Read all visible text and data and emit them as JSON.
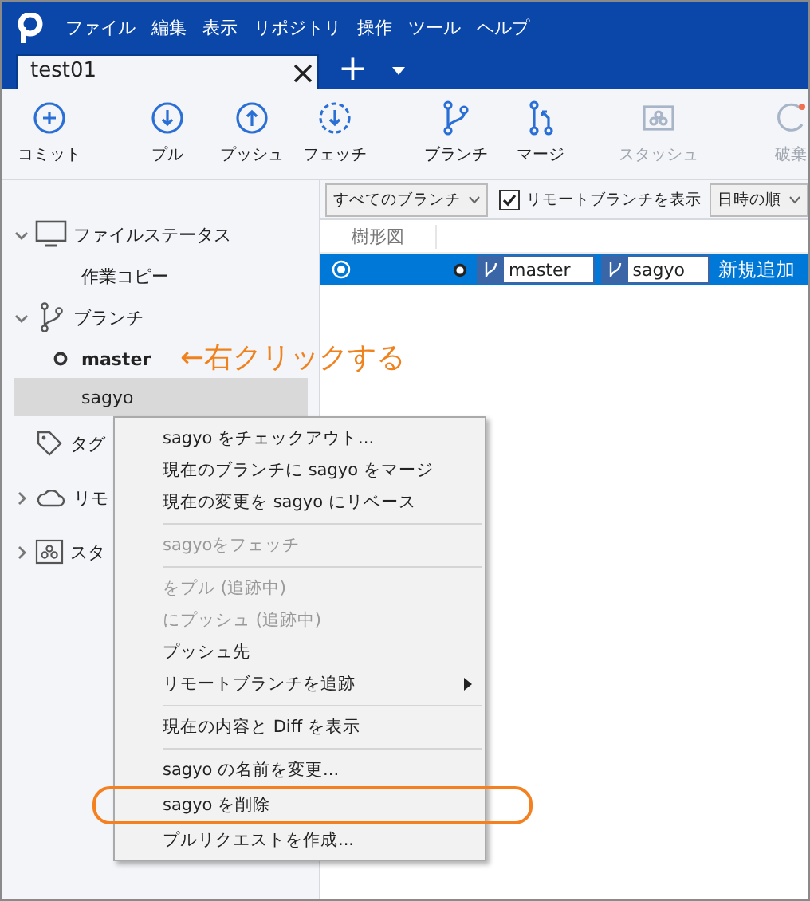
{
  "menubar": [
    "ファイル",
    "編集",
    "表示",
    "リポジトリ",
    "操作",
    "ツール",
    "ヘルプ"
  ],
  "tabs": [
    {
      "label": "test01",
      "selected": true
    }
  ],
  "tab_add": "+",
  "toolbar": [
    {
      "label": "コミット",
      "kind": "commit",
      "disabled": false
    },
    {
      "label": "プル",
      "kind": "pull",
      "disabled": false
    },
    {
      "label": "プッシュ",
      "kind": "push",
      "disabled": false
    },
    {
      "label": "フェッチ",
      "kind": "fetch",
      "disabled": false
    },
    {
      "label": "ブランチ",
      "kind": "branch",
      "disabled": false
    },
    {
      "label": "マージ",
      "kind": "merge",
      "disabled": false
    },
    {
      "label": "スタッシュ",
      "kind": "stash",
      "disabled": true
    },
    {
      "label": "破棄",
      "kind": "discard",
      "disabled": true
    }
  ],
  "sidebar": [
    {
      "label": "ファイルステータス",
      "kind": "status",
      "expanded": true,
      "children": [
        {
          "label": "作業コピー",
          "current": false,
          "selected": false
        }
      ]
    },
    {
      "label": "ブランチ",
      "kind": "branch",
      "expanded": true,
      "children": [
        {
          "label": "master",
          "current": true,
          "selected": false
        },
        {
          "label": "sagyo",
          "current": false,
          "selected": true
        }
      ]
    },
    {
      "label": "タグ",
      "kind": "tag"
    },
    {
      "label": "リモ",
      "kind": "remote",
      "expanded": false
    },
    {
      "label": "スタ",
      "kind": "stash",
      "expanded": false
    }
  ],
  "history": {
    "branch_filter": "すべてのブランチ",
    "show_remote": {
      "label": "リモートブランチを表示",
      "checked": true
    },
    "sort": "日時の順",
    "columns": [
      "樹形図"
    ],
    "rows": [
      {
        "selected": true,
        "branches": [
          "master",
          "sagyo"
        ],
        "message": "新規追加"
      }
    ]
  },
  "annotation": "←右クリックする",
  "context_menu": [
    {
      "kind": "item",
      "label": "sagyo をチェックアウト...",
      "disabled": false,
      "submenu": false,
      "highlighted": false
    },
    {
      "kind": "item",
      "label": "現在のブランチに sagyo をマージ",
      "disabled": false,
      "submenu": false,
      "highlighted": false
    },
    {
      "kind": "item",
      "label": "現在の変更を sagyo にリベース",
      "disabled": false,
      "submenu": false,
      "highlighted": false
    },
    {
      "kind": "separator"
    },
    {
      "kind": "item",
      "label": "sagyoをフェッチ",
      "disabled": true,
      "submenu": false,
      "highlighted": false
    },
    {
      "kind": "separator"
    },
    {
      "kind": "item",
      "label": "をプル (追跡中)",
      "disabled": true,
      "submenu": false,
      "highlighted": false
    },
    {
      "kind": "item",
      "label": "にプッシュ (追跡中)",
      "disabled": true,
      "submenu": false,
      "highlighted": false
    },
    {
      "kind": "item",
      "label": "プッシュ先",
      "disabled": false,
      "submenu": false,
      "highlighted": false
    },
    {
      "kind": "item",
      "label": "リモートブランチを追跡",
      "disabled": false,
      "submenu": true,
      "highlighted": false
    },
    {
      "kind": "separator"
    },
    {
      "kind": "item",
      "label": "現在の内容と Diff を表示",
      "disabled": false,
      "submenu": false,
      "highlighted": false
    },
    {
      "kind": "separator"
    },
    {
      "kind": "item",
      "label": "sagyo の名前を変更...",
      "disabled": false,
      "submenu": false,
      "highlighted": false
    },
    {
      "kind": "item",
      "label": "sagyo を削除",
      "disabled": false,
      "submenu": false,
      "highlighted": true
    },
    {
      "kind": "item",
      "label": "プルリクエストを作成...",
      "disabled": false,
      "submenu": false,
      "highlighted": false
    }
  ]
}
